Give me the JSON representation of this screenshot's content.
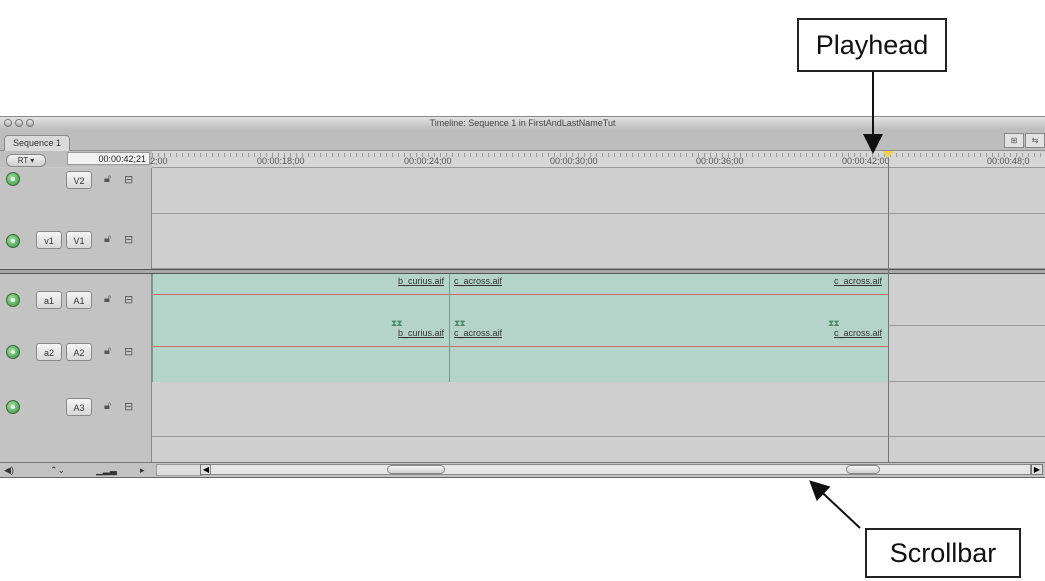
{
  "window": {
    "title": "Timeline: Sequence 1 in FirstAndLastNameTut",
    "tab_label": "Sequence 1",
    "rt_label": "RT ▾",
    "timecode": "00:00:42;21"
  },
  "ruler": {
    "labels": [
      "2;00",
      "00:00:18;00",
      "00:00:24;00",
      "00:00:30;00",
      "00:00:36;00",
      "00:00:42;00",
      "00:00:48;0"
    ]
  },
  "tracks": {
    "v2": {
      "dest": "",
      "label": "V2"
    },
    "v1": {
      "dest": "v1",
      "label": "V1"
    },
    "a1": {
      "dest": "a1",
      "label": "A1"
    },
    "a2": {
      "dest": "a2",
      "label": "A2"
    },
    "a3": {
      "dest": "",
      "label": "A3"
    }
  },
  "clips": {
    "a1_first": "b_curius.aif",
    "a1_second": "c_across.aif",
    "a1_second_end": "c_across.aif",
    "a2_first": "b_curius.aif",
    "a2_second": "c_across.aif",
    "a2_second_end": "c_across.aif"
  },
  "callouts": {
    "playhead": "Playhead",
    "scrollbar": "Scrollbar"
  },
  "icons": {
    "lock": "lock-icon",
    "auto_select": "auto-select-icon",
    "speaker": "speaker-icon",
    "visibility": "visibility-icon"
  },
  "colors": {
    "audio_clip": "#b4d4c9",
    "audio_level_line": "#c86c6c",
    "playhead_marker": "#f2d34c"
  }
}
